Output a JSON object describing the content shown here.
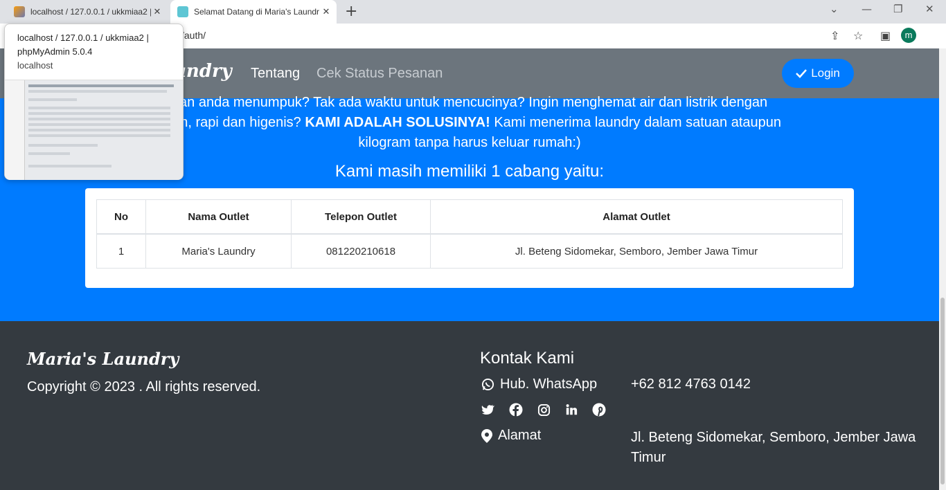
{
  "browser": {
    "tabs": [
      {
        "title": "localhost / 127.0.0.1 / ukkmiaa2 | ",
        "active": false
      },
      {
        "title": "Selamat Datang di Maria's Laundr",
        "active": true
      }
    ],
    "url": "/auth/",
    "profile_initial": "m",
    "tooltip": {
      "title": "localhost / 127.0.0.1 / ukkmiaa2 | phpMyAdmin 5.0.4",
      "host": "localhost"
    }
  },
  "navbar": {
    "brand": "undry",
    "links": [
      "Tentang",
      "Cek Status Pesanan"
    ],
    "login_label": "Login"
  },
  "hero": {
    "line1": "uan anda menumpuk? Tak ada waktu untuk mencucinya? Ingin menghemat air dan listrik dengan",
    "line2_pre": "ersih, rapi dan higenis? ",
    "line2_bold": "KAMI ADALAH SOLUSINYA!",
    "line2_post": " Kami menerima laundry dalam satuan ataupun",
    "line3": "kilogram tanpa harus keluar rumah:)",
    "branches_heading": "Kami masih memiliki 1 cabang yaitu:"
  },
  "table": {
    "headers": [
      "No",
      "Nama Outlet",
      "Telepon Outlet",
      "Alamat Outlet"
    ],
    "rows": [
      [
        "1",
        "Maria's Laundry",
        "081220210618",
        "Jl. Beteng Sidomekar, Semboro, Jember Jawa Timur"
      ]
    ]
  },
  "footer": {
    "brand": "Maria's Laundry",
    "copyright": "Copyright © 2023 . All rights reserved.",
    "contact_heading": "Kontak Kami",
    "whatsapp_label": "Hub. WhatsApp",
    "phone": "+62 812 4763 0142",
    "address_label": "Alamat",
    "address": "Jl. Beteng Sidomekar, Semboro, Jember Jawa Timur"
  },
  "colors": {
    "primary": "#007bff",
    "navbar": "#6c757d",
    "footer": "#343a40"
  }
}
